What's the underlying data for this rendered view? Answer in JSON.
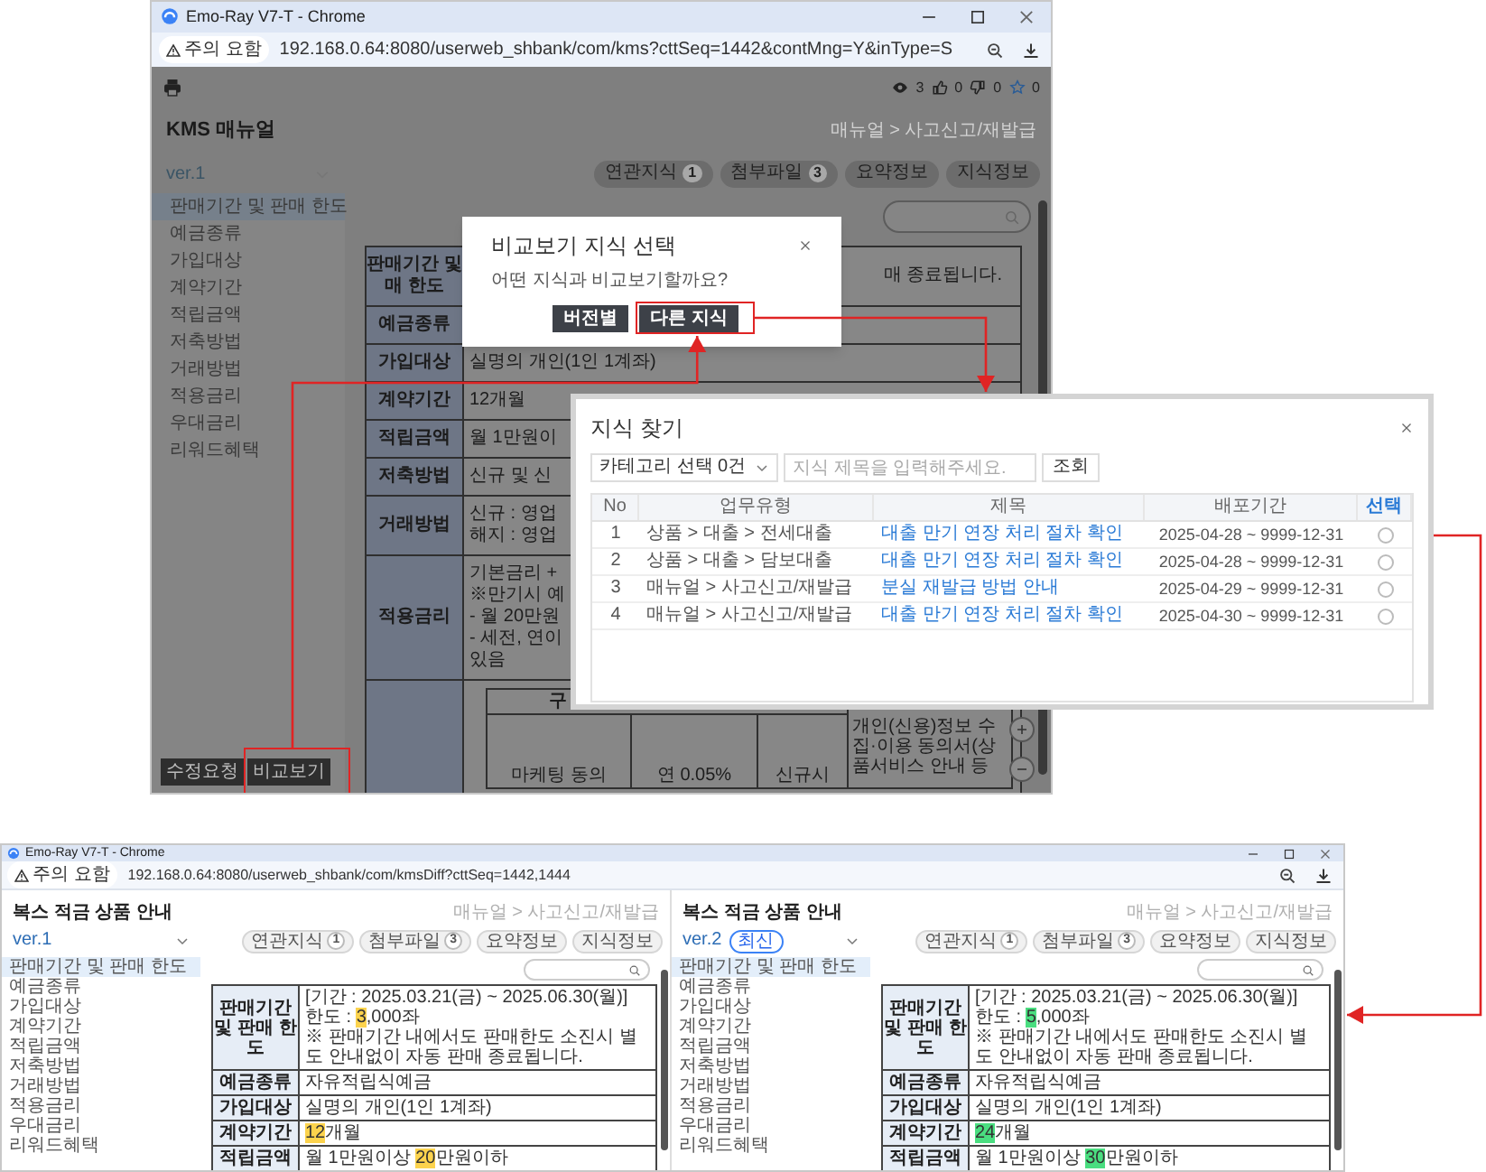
{
  "kms_window": {
    "title": "Emo-Ray V7-T - Chrome",
    "warning": "주의 요함",
    "url": "192.168.0.64:8080/userweb_shbank/com/kms?cttSeq=1442&contMng=Y&inType=S",
    "stats": [
      {
        "kind": "views",
        "count": "3"
      },
      {
        "kind": "likes",
        "count": "0"
      },
      {
        "kind": "dislikes",
        "count": "0"
      },
      {
        "kind": "favorites",
        "count": "0"
      }
    ],
    "page_title": "KMS 매뉴얼",
    "breadcrumb": "매뉴얼 > 사고신고/재발급",
    "version": "ver.1",
    "tabs": [
      {
        "label": "연관지식",
        "count": "1"
      },
      {
        "label": "첨부파일",
        "count": "3"
      },
      {
        "label": "요약정보"
      },
      {
        "label": "지식정보"
      }
    ],
    "sidebar": [
      {
        "label": "판매기간 및 판매 한도",
        "selected": true
      },
      {
        "label": "예금종류",
        "selected": false
      },
      {
        "label": "가입대상",
        "selected": false
      },
      {
        "label": "계약기간",
        "selected": false
      },
      {
        "label": "적립금액",
        "selected": false
      },
      {
        "label": "저축방법",
        "selected": false
      },
      {
        "label": "거래방법",
        "selected": false
      },
      {
        "label": "적용금리",
        "selected": false
      },
      {
        "label": "우대금리",
        "selected": false
      },
      {
        "label": "리워드혜택",
        "selected": false
      }
    ],
    "rows": [
      {
        "label": [
          "판매기간 및",
          "매 한도"
        ],
        "value": [
          "매 종료됩니다."
        ]
      },
      {
        "label": [
          "예금종류"
        ]
      },
      {
        "label": [
          "가입대상"
        ],
        "value": [
          "실명의 개인(1인 1계좌)"
        ]
      },
      {
        "label": [
          "계약기간"
        ],
        "value": [
          "12개월"
        ]
      },
      {
        "label": [
          "적립금액"
        ],
        "value": [
          "월 1만원이"
        ]
      },
      {
        "label": [
          "저축방법"
        ],
        "value": [
          "신규 및 신"
        ]
      },
      {
        "label": [
          "거래방법"
        ],
        "value": [
          "신규 : 영업",
          "해지 : 영업"
        ]
      },
      {
        "label": [
          "적용금리"
        ],
        "value": [
          "기본금리 +",
          "※만기시 예",
          "- 월 20만원",
          "- 세전, 연이",
          "있음"
        ]
      }
    ],
    "benefit_table": {
      "header": "구",
      "cells": [
        "마케팅 동의",
        "연 0.05%",
        "신규시"
      ],
      "note": [
        "개인(신용)정보 수",
        "집·이용 동의서(상",
        "품서비스 안내 등"
      ]
    },
    "buttons": [
      {
        "label": "수정요청",
        "highlighted": false
      },
      {
        "label": "비교보기",
        "highlighted": true
      }
    ]
  },
  "compare_dialog": {
    "title": "비교보기 지식 선택",
    "message": "어떤 지식과 비교보기할까요?",
    "buttons": [
      {
        "label": "버전별",
        "highlighted": false
      },
      {
        "label": "다른 지식",
        "highlighted": true
      }
    ]
  },
  "find_dialog": {
    "title": "지식 찾기",
    "category": "카테고리 선택 0건",
    "search": {
      "placeholder": "지식 제목을 입력해주세요."
    },
    "search_button": "조회",
    "columns": [
      "No",
      "업무유형",
      "제목",
      "배포기간",
      "선택"
    ],
    "rows": [
      {
        "no": "1",
        "type": "상품 > 대출 > 전세대출",
        "title": "대출 만기 연장 처리 절차 확인",
        "period": "2025-04-28 ~ 9999-12-31",
        "selected": false
      },
      {
        "no": "2",
        "type": "상품 > 대출 > 담보대출",
        "title": "대출 만기 연장 처리 절차 확인",
        "period": "2025-04-28 ~ 9999-12-31",
        "selected": false
      },
      {
        "no": "3",
        "type": "매뉴얼 > 사고신고/재발급",
        "title": "분실 재발급 방법 안내",
        "period": "2025-04-29 ~ 9999-12-31",
        "selected": false
      },
      {
        "no": "4",
        "type": "매뉴얼 > 사고신고/재발급",
        "title": "대출 만기 연장 처리 절차 확인",
        "period": "2025-04-30 ~ 9999-12-31",
        "selected": false
      }
    ]
  },
  "diff_window": {
    "title": "Emo-Ray V7-T - Chrome",
    "warning": "주의 요함",
    "url": "192.168.0.64:8080/userweb_shbank/com/kmsDiff?cttSeq=1442,1444",
    "panels": [
      {
        "kind": "before",
        "page_title": "복스 적금 상품 안내",
        "breadcrumb": "매뉴얼 > 사고신고/재발급",
        "version": "ver.1",
        "tabs": [
          {
            "label": "연관지식",
            "count": "1"
          },
          {
            "label": "첨부파일",
            "count": "3"
          },
          {
            "label": "요약정보"
          },
          {
            "label": "지식정보"
          }
        ],
        "sidebar": [
          {
            "label": "판매기간 및 판매 한도",
            "selected": true
          },
          {
            "label": "예금종류",
            "selected": false
          },
          {
            "label": "가입대상",
            "selected": false
          },
          {
            "label": "계약기간",
            "selected": false
          },
          {
            "label": "적립금액",
            "selected": false
          },
          {
            "label": "저축방법",
            "selected": false
          },
          {
            "label": "거래방법",
            "selected": false
          },
          {
            "label": "적용금리",
            "selected": false
          },
          {
            "label": "우대금리",
            "selected": false
          },
          {
            "label": "리워드혜택",
            "selected": false
          }
        ],
        "rows": [
          {
            "label": "판매기간 및 판매 한도",
            "lines": [
              [
                {
                  "text": "[기간 : 2025.03.21(금) ~ 2025.06.30(월)]",
                  "changed": false
                }
              ],
              [
                {
                  "text": "한도 : ",
                  "changed": false
                },
                {
                  "text": "3",
                  "changed": true
                },
                {
                  "text": ",000좌",
                  "changed": false
                }
              ],
              [
                {
                  "text": "※ 판매기간 내에서도 판매한도 소진시 별도 안내없이 자동 판매 종료됩니다.",
                  "changed": false
                }
              ]
            ]
          },
          {
            "label": "예금종류",
            "lines": [
              [
                {
                  "text": "자유적립식예금",
                  "changed": false
                }
              ]
            ]
          },
          {
            "label": "가입대상",
            "lines": [
              [
                {
                  "text": "실명의 개인(1인 1계좌)",
                  "changed": false
                }
              ]
            ]
          },
          {
            "label": "계약기간",
            "lines": [
              [
                {
                  "text": "12",
                  "changed": true
                },
                {
                  "text": "개월",
                  "changed": false
                }
              ]
            ]
          },
          {
            "label": "적립금액",
            "lines": [
              [
                {
                  "text": "월 1만원이상 ",
                  "changed": false
                },
                {
                  "text": "20",
                  "changed": true
                },
                {
                  "text": "만원이하",
                  "changed": false
                }
              ]
            ]
          }
        ]
      },
      {
        "kind": "after",
        "page_title": "복스 적금 상품 안내",
        "breadcrumb": "매뉴얼 > 사고신고/재발급",
        "version": "ver.2",
        "badge": "최신",
        "tabs": [
          {
            "label": "연관지식",
            "count": "1"
          },
          {
            "label": "첨부파일",
            "count": "3"
          },
          {
            "label": "요약정보"
          },
          {
            "label": "지식정보"
          }
        ],
        "sidebar": [
          {
            "label": "판매기간 및 판매 한도",
            "selected": true
          },
          {
            "label": "예금종류",
            "selected": false
          },
          {
            "label": "가입대상",
            "selected": false
          },
          {
            "label": "계약기간",
            "selected": false
          },
          {
            "label": "적립금액",
            "selected": false
          },
          {
            "label": "저축방법",
            "selected": false
          },
          {
            "label": "거래방법",
            "selected": false
          },
          {
            "label": "적용금리",
            "selected": false
          },
          {
            "label": "우대금리",
            "selected": false
          },
          {
            "label": "리워드혜택",
            "selected": false
          }
        ],
        "rows": [
          {
            "label": "판매기간 및 판매 한도",
            "lines": [
              [
                {
                  "text": "[기간 : 2025.03.21(금) ~ 2025.06.30(월)]",
                  "changed": false
                }
              ],
              [
                {
                  "text": "한도 : ",
                  "changed": false
                },
                {
                  "text": "5",
                  "changed": true
                },
                {
                  "text": ",000좌",
                  "changed": false
                }
              ],
              [
                {
                  "text": "※ 판매기간 내에서도 판매한도 소진시 별도 안내없이 자동 판매 종료됩니다.",
                  "changed": false
                }
              ]
            ]
          },
          {
            "label": "예금종류",
            "lines": [
              [
                {
                  "text": "자유적립식예금",
                  "changed": false
                }
              ]
            ]
          },
          {
            "label": "가입대상",
            "lines": [
              [
                {
                  "text": "실명의 개인(1인 1계좌)",
                  "changed": false
                }
              ]
            ]
          },
          {
            "label": "계약기간",
            "lines": [
              [
                {
                  "text": "24",
                  "changed": true
                },
                {
                  "text": "개월",
                  "changed": false
                }
              ]
            ]
          },
          {
            "label": "적립금액",
            "lines": [
              [
                {
                  "text": "월 1만원이상 ",
                  "changed": false
                },
                {
                  "text": "30",
                  "changed": true
                },
                {
                  "text": "만원이하",
                  "changed": false
                }
              ]
            ]
          }
        ]
      }
    ]
  }
}
